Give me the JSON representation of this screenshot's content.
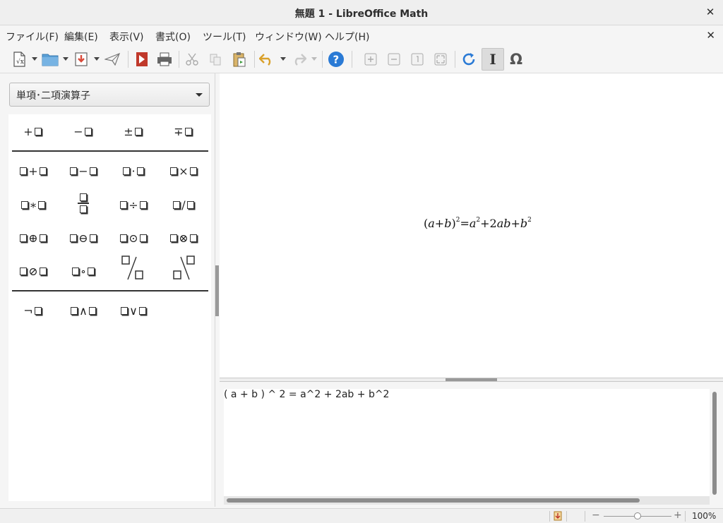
{
  "window": {
    "title": "無題 1 - LibreOffice Math",
    "close_symbol": "✕"
  },
  "menu": {
    "items": [
      "ファイル(F)",
      "編集(E)",
      "表示(V)",
      "書式(O)",
      "ツール(T)",
      "ウィンドウ(W)",
      "ヘルプ(H)"
    ],
    "close_document_symbol": "✕"
  },
  "toolbar": {
    "icons": [
      "new-icon",
      "open-icon",
      "save-icon",
      "send-icon",
      "pdf-export-icon",
      "print-icon",
      "cut-icon",
      "copy-icon",
      "paste-icon",
      "undo-icon",
      "redo-icon",
      "help-icon",
      "zoom-in-icon",
      "zoom-out-icon",
      "show-all-icon",
      "fit-icon",
      "update-icon",
      "formula-cursor-icon",
      "symbols-icon"
    ],
    "formula_cursor_symbol": "I",
    "symbols_symbol": "Ω"
  },
  "elements": {
    "category": "単項･二項演算子",
    "unary": [
      "+",
      "−",
      "±",
      "∓"
    ],
    "binary_row1": [
      "+",
      "−",
      "·",
      "×"
    ],
    "binary_row2": [
      "∗",
      "÷",
      "/"
    ],
    "binary_row3": [
      "⊕",
      "⊖",
      "⊙",
      "⊗"
    ],
    "binary_row4": [
      "⊘",
      "∘"
    ],
    "logic": [
      "¬",
      "∧",
      "∨"
    ]
  },
  "formula": {
    "rendered_parts": [
      "(",
      "a",
      "+",
      "b",
      ")",
      "2",
      "=",
      "a",
      "2",
      "+",
      "2",
      "ab",
      "+",
      "b",
      "2"
    ]
  },
  "editor": {
    "text": "( a + b ) ^ 2 = a^2 + 2ab + b^2"
  },
  "status": {
    "zoom": "100%",
    "zoom_fraction": 0.5
  },
  "colors": {
    "help_icon": "#2a7ad5",
    "update_icon": "#2a7ad5",
    "save_icon": "#d94a3a",
    "pdf_icon": "#c0392b",
    "folder_icon": "#5a9fd6"
  }
}
